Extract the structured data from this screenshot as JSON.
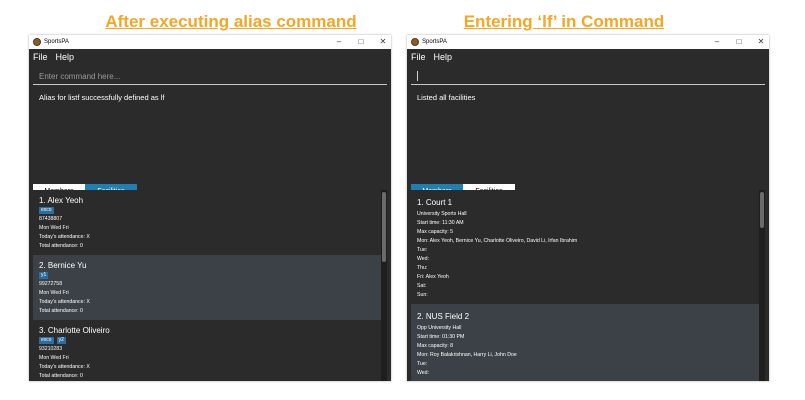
{
  "captions": {
    "left": "After executing alias command",
    "right": "Entering ‘lf’ in Command"
  },
  "colors": {
    "caption": "#f5a623",
    "tab_selected": "#1f7fb0",
    "app_bg": "#2b2b2b"
  },
  "left_window": {
    "app_title": "SportsPA",
    "controls": {
      "min": "–",
      "max": "□",
      "close": "✕"
    },
    "menu": [
      "File",
      "Help"
    ],
    "command_placeholder": "Enter command here...",
    "result": "Alias for listf successfully defined as lf",
    "tabs": [
      {
        "label": "Members",
        "selected": false
      },
      {
        "label": "Facilities",
        "selected": true
      }
    ],
    "members": [
      {
        "title": "1.  Alex Yeoh",
        "tags": [
          "exco"
        ],
        "phone": "87438807",
        "days": "Mon Wed Fri",
        "today": "Today's attendance: X",
        "total": "Total attendance: 0"
      },
      {
        "title": "2.  Bernice Yu",
        "tags": [
          "y1"
        ],
        "phone": "99272758",
        "days": "Mon Wed Fri",
        "today": "Today's attendance: X",
        "total": "Total attendance: 0"
      },
      {
        "title": "3.  Charlotte Oliveiro",
        "tags": [
          "exco",
          "y2"
        ],
        "phone": "93210283",
        "days": "Mon Wed Fri",
        "today": "Today's attendance: X",
        "total": "Total attendance: 0"
      }
    ]
  },
  "right_window": {
    "app_title": "SportsPA",
    "controls": {
      "min": "–",
      "max": "□",
      "close": "✕"
    },
    "menu": [
      "File",
      "Help"
    ],
    "command_value": "",
    "result": "Listed all facilities",
    "tabs": [
      {
        "label": "Members",
        "selected": true
      },
      {
        "label": "Facilities",
        "selected": false
      }
    ],
    "facilities": [
      {
        "title": "1. Court 1",
        "lines": [
          "University Sports Hall",
          "Start time: 11:30 AM",
          "Max capacity: 5",
          "Mon: Alex Yeoh, Bernice Yu, Charlotte Oliveiro, David Li, Irfan Ibrahim",
          "Tue:",
          "Wed:",
          "Thu:",
          "Fri: Alex Yeoh",
          "Sat:",
          "Sun:"
        ]
      },
      {
        "title": "2. NUS Field 2",
        "lines": [
          "Opp University Hall",
          "Start time: 01:30 PM",
          "Max capacity: 8",
          "Mon: Roy Balakrishnan, Harry Li, John Doe",
          "Tue:",
          "Wed:"
        ]
      }
    ]
  }
}
